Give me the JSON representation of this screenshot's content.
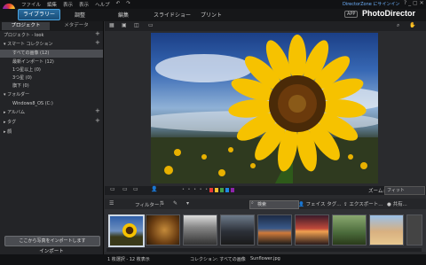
{
  "menu": {
    "file": "ファイル",
    "edit": "編集",
    "view": "表示",
    "display": "表示",
    "help": "ヘルプ"
  },
  "app": {
    "title": "PhotoDirector",
    "upgrade": "APP",
    "promo": "DirectorZone にサインイン"
  },
  "modes": {
    "library": "ライブラリー",
    "adjust": "調整",
    "edit": "編集",
    "slideshow": "スライドショー",
    "print": "プリント"
  },
  "left": {
    "tab_project": "プロジェクト",
    "tab_metadata": "メタデータ",
    "project_label": "プロジェクト - look",
    "smart_collection": "スマート コレクション",
    "items": [
      "すべての画像 (12)",
      "最新インポート (12)",
      "1つ星以上 (0)",
      "3つ星 (0)",
      "旗下 (0)"
    ],
    "folders": "フォルダー",
    "folder_item": "Windows8_OS (C:)",
    "album": "アルバム",
    "tag": "タグ",
    "people": "顔",
    "import_hint": "ここから写真をインポートします",
    "import": "インポート"
  },
  "filter": {
    "filter_label": "フィルター:",
    "search_placeholder": "検索",
    "face": "フェイス タグ...",
    "export": "エクスポート...",
    "share": "共有..."
  },
  "zoom": {
    "label": "ズーム:",
    "value": "フィット"
  },
  "status": {
    "count": "1 枚選択 - 12 枚表示",
    "collection": "コレクション: すべての画像",
    "file": "Sunflower.jpg"
  },
  "colors": {
    "accent": "#2a6da0",
    "label_red": "#e53935",
    "label_yellow": "#fbc02d",
    "label_green": "#43a047",
    "label_blue": "#1e88e5",
    "label_purple": "#8e24aa"
  }
}
